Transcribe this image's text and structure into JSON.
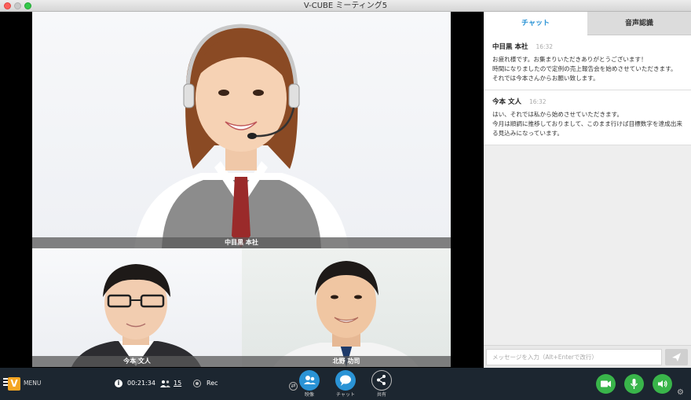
{
  "window": {
    "title": "V-CUBE ミーティング5"
  },
  "videos": {
    "main": {
      "name": "中目黒 本社"
    },
    "bottom_left": {
      "name": "今本 文人"
    },
    "bottom_right": {
      "name": "北野 功司"
    }
  },
  "panel": {
    "tabs": [
      {
        "label": "チャット",
        "active": true
      },
      {
        "label": "音声認識",
        "active": false
      }
    ],
    "messages": [
      {
        "sender": "中目黒 本社",
        "time": "16:32",
        "body": "お疲れ様です。お集まりいただきありがとうございます！\n時間になりましたので定例の売上報告会を始めさせていただきます。それでは今本さんからお願い致します。"
      },
      {
        "sender": "今本 文人",
        "time": "16:32",
        "body": "はい、それでは私から始めさせていただきます。\n今月は順調に推移しておりまして、このまま行けば目標数字を達成出来る見込みになっています。"
      }
    ],
    "input_placeholder": "メッセージを入力（Alt+Enterで改行）"
  },
  "toolbar": {
    "logo": "V",
    "menu_label": "MENU",
    "timer": "00:21:34",
    "participants": "15",
    "rec_label": "Rec",
    "video_label": "映像",
    "chat_label": "チャット",
    "share_label": "共有"
  },
  "colors": {
    "accent": "#2a93d5",
    "toolbar_bg": "#1c2630",
    "green": "#39b54a",
    "logo": "#f5a623"
  }
}
